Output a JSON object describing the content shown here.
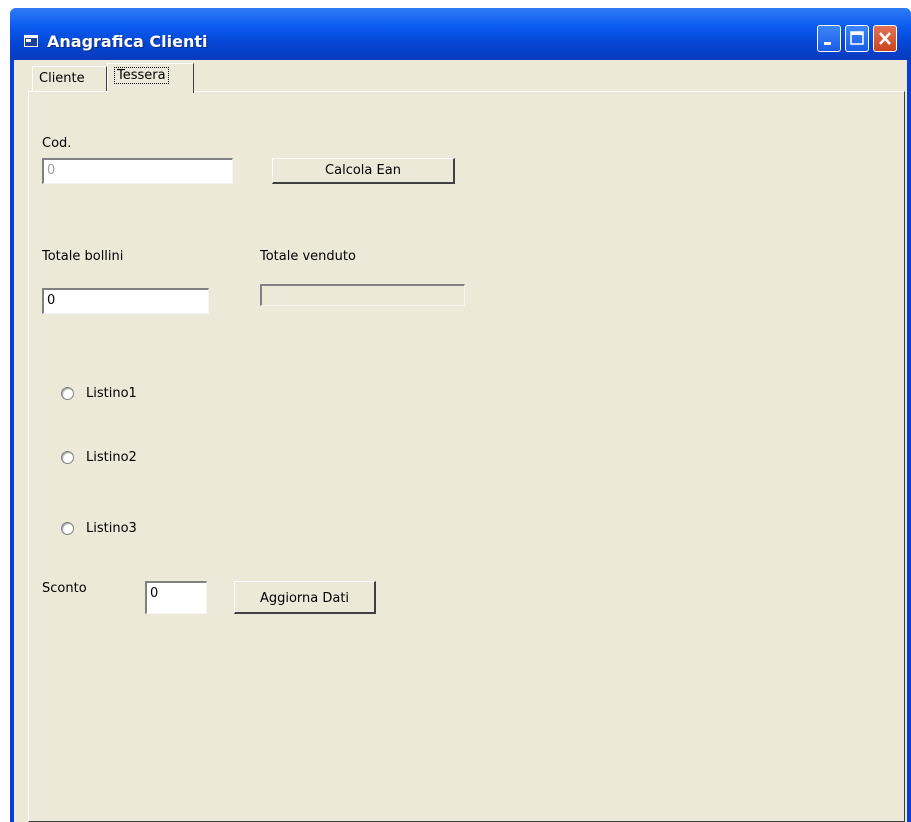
{
  "window": {
    "title": "Anagrafica Clienti"
  },
  "tabs": [
    {
      "label": "Cliente"
    },
    {
      "label": "Tessera"
    }
  ],
  "form": {
    "cod_label": "Cod.",
    "cod_value": "0",
    "calcola_button": "Calcola Ean",
    "totale_bollini_label": "Totale bollini",
    "totale_bollini_value": "0",
    "totale_venduto_label": "Totale venduto",
    "totale_venduto_value": "",
    "listino1_label": "Listino1",
    "listino2_label": "Listino2",
    "listino3_label": "Listino3",
    "sconto_label": "Sconto",
    "sconto_value": "0",
    "aggiorna_button": "Aggiorna Dati"
  },
  "colors": {
    "titlebar": "#0a5cf0",
    "face": "#ece9d8",
    "close_button": "#c9441f"
  }
}
